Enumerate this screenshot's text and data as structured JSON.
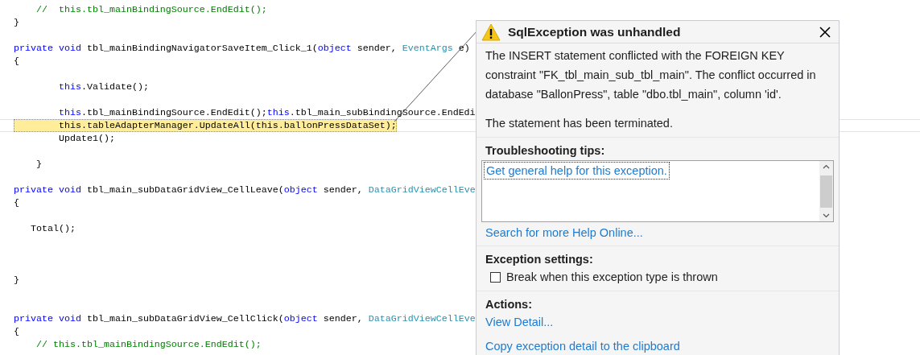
{
  "code_lines": [
    {
      "kind": "code",
      "highlighted": false,
      "tokens": [
        {
          "text": "    //  this.tbl_mainBindingSource.EndEdit();",
          "kind": "comment"
        }
      ]
    },
    {
      "kind": "code",
      "highlighted": false,
      "tokens": [
        {
          "text": "}",
          "kind": "plain"
        }
      ]
    },
    {
      "kind": "blank"
    },
    {
      "kind": "code",
      "highlighted": false,
      "tokens": [
        {
          "text": "private void",
          "kind": "keyword"
        },
        {
          "text": " tbl_mainBindingNavigatorSaveItem_Click_1(",
          "kind": "plain"
        },
        {
          "text": "object",
          "kind": "keyword"
        },
        {
          "text": " sender, ",
          "kind": "plain"
        },
        {
          "text": "EventArgs",
          "kind": "type"
        },
        {
          "text": " e)",
          "kind": "plain"
        }
      ]
    },
    {
      "kind": "code",
      "highlighted": false,
      "tokens": [
        {
          "text": "{",
          "kind": "plain"
        }
      ]
    },
    {
      "kind": "blank"
    },
    {
      "kind": "code",
      "highlighted": false,
      "tokens": [
        {
          "text": "        this",
          "kind": "keyword"
        },
        {
          "text": ".Validate();",
          "kind": "plain"
        }
      ]
    },
    {
      "kind": "blank"
    },
    {
      "kind": "code",
      "highlighted": false,
      "tokens": [
        {
          "text": "        this",
          "kind": "keyword"
        },
        {
          "text": ".tbl_mainBindingSource.EndEdit();",
          "kind": "plain"
        },
        {
          "text": "this",
          "kind": "keyword"
        },
        {
          "text": ".tbl_main_subBindingSource.EndEdi",
          "kind": "plain"
        }
      ]
    },
    {
      "kind": "code",
      "highlighted": true,
      "tokens": [
        {
          "text": "        this.tableAdapterManager.UpdateAll(this.ballonPressDataSet);",
          "kind": "plain"
        }
      ]
    },
    {
      "kind": "code",
      "highlighted": false,
      "tokens": [
        {
          "text": "        Update1();",
          "kind": "plain"
        }
      ]
    },
    {
      "kind": "blank"
    },
    {
      "kind": "code",
      "highlighted": false,
      "tokens": [
        {
          "text": "    }",
          "kind": "plain"
        }
      ]
    },
    {
      "kind": "blank"
    },
    {
      "kind": "code",
      "highlighted": false,
      "tokens": [
        {
          "text": "private void",
          "kind": "keyword"
        },
        {
          "text": " tbl_main_subDataGridView_CellLeave(",
          "kind": "plain"
        },
        {
          "text": "object",
          "kind": "keyword"
        },
        {
          "text": " sender, ",
          "kind": "plain"
        },
        {
          "text": "DataGridViewCellEve",
          "kind": "type"
        }
      ]
    },
    {
      "kind": "code",
      "highlighted": false,
      "tokens": [
        {
          "text": "{",
          "kind": "plain"
        }
      ]
    },
    {
      "kind": "blank"
    },
    {
      "kind": "code",
      "highlighted": false,
      "tokens": [
        {
          "text": "   Total();",
          "kind": "plain"
        }
      ]
    },
    {
      "kind": "blank"
    },
    {
      "kind": "blank"
    },
    {
      "kind": "blank"
    },
    {
      "kind": "code",
      "highlighted": false,
      "tokens": [
        {
          "text": "}",
          "kind": "plain"
        }
      ]
    },
    {
      "kind": "blank"
    },
    {
      "kind": "blank"
    },
    {
      "kind": "code",
      "highlighted": false,
      "tokens": [
        {
          "text": "private void",
          "kind": "keyword"
        },
        {
          "text": " tbl_main_subDataGridView_CellClick(",
          "kind": "plain"
        },
        {
          "text": "object",
          "kind": "keyword"
        },
        {
          "text": " sender, ",
          "kind": "plain"
        },
        {
          "text": "DataGridViewCellEve",
          "kind": "type"
        }
      ]
    },
    {
      "kind": "code",
      "highlighted": false,
      "tokens": [
        {
          "text": "{",
          "kind": "plain"
        }
      ]
    },
    {
      "kind": "code",
      "highlighted": false,
      "tokens": [
        {
          "text": "    // this.tbl_mainBindingSource.EndEdit();",
          "kind": "comment"
        }
      ]
    }
  ],
  "exception_popup": {
    "title": "SqlException was unhandled",
    "message": [
      "The INSERT statement conflicted with the FOREIGN KEY constraint \"FK_tbl_main_sub_tbl_main\". The conflict occurred in database \"BallonPress\", table \"dbo.tbl_main\", column 'id'.",
      "The statement has been terminated."
    ],
    "troubleshooting": {
      "heading": "Troubleshooting tips:",
      "tips": [
        {
          "text": "Get general help for this exception.",
          "selected": true
        }
      ]
    },
    "help_link": "Search for more Help Online...",
    "settings": {
      "heading": "Exception settings:",
      "options": [
        {
          "label": "Break when this exception type is thrown",
          "checked": false
        }
      ]
    },
    "actions": {
      "heading": "Actions:",
      "links": [
        "View Detail...",
        "Copy exception detail to the clipboard"
      ]
    }
  }
}
